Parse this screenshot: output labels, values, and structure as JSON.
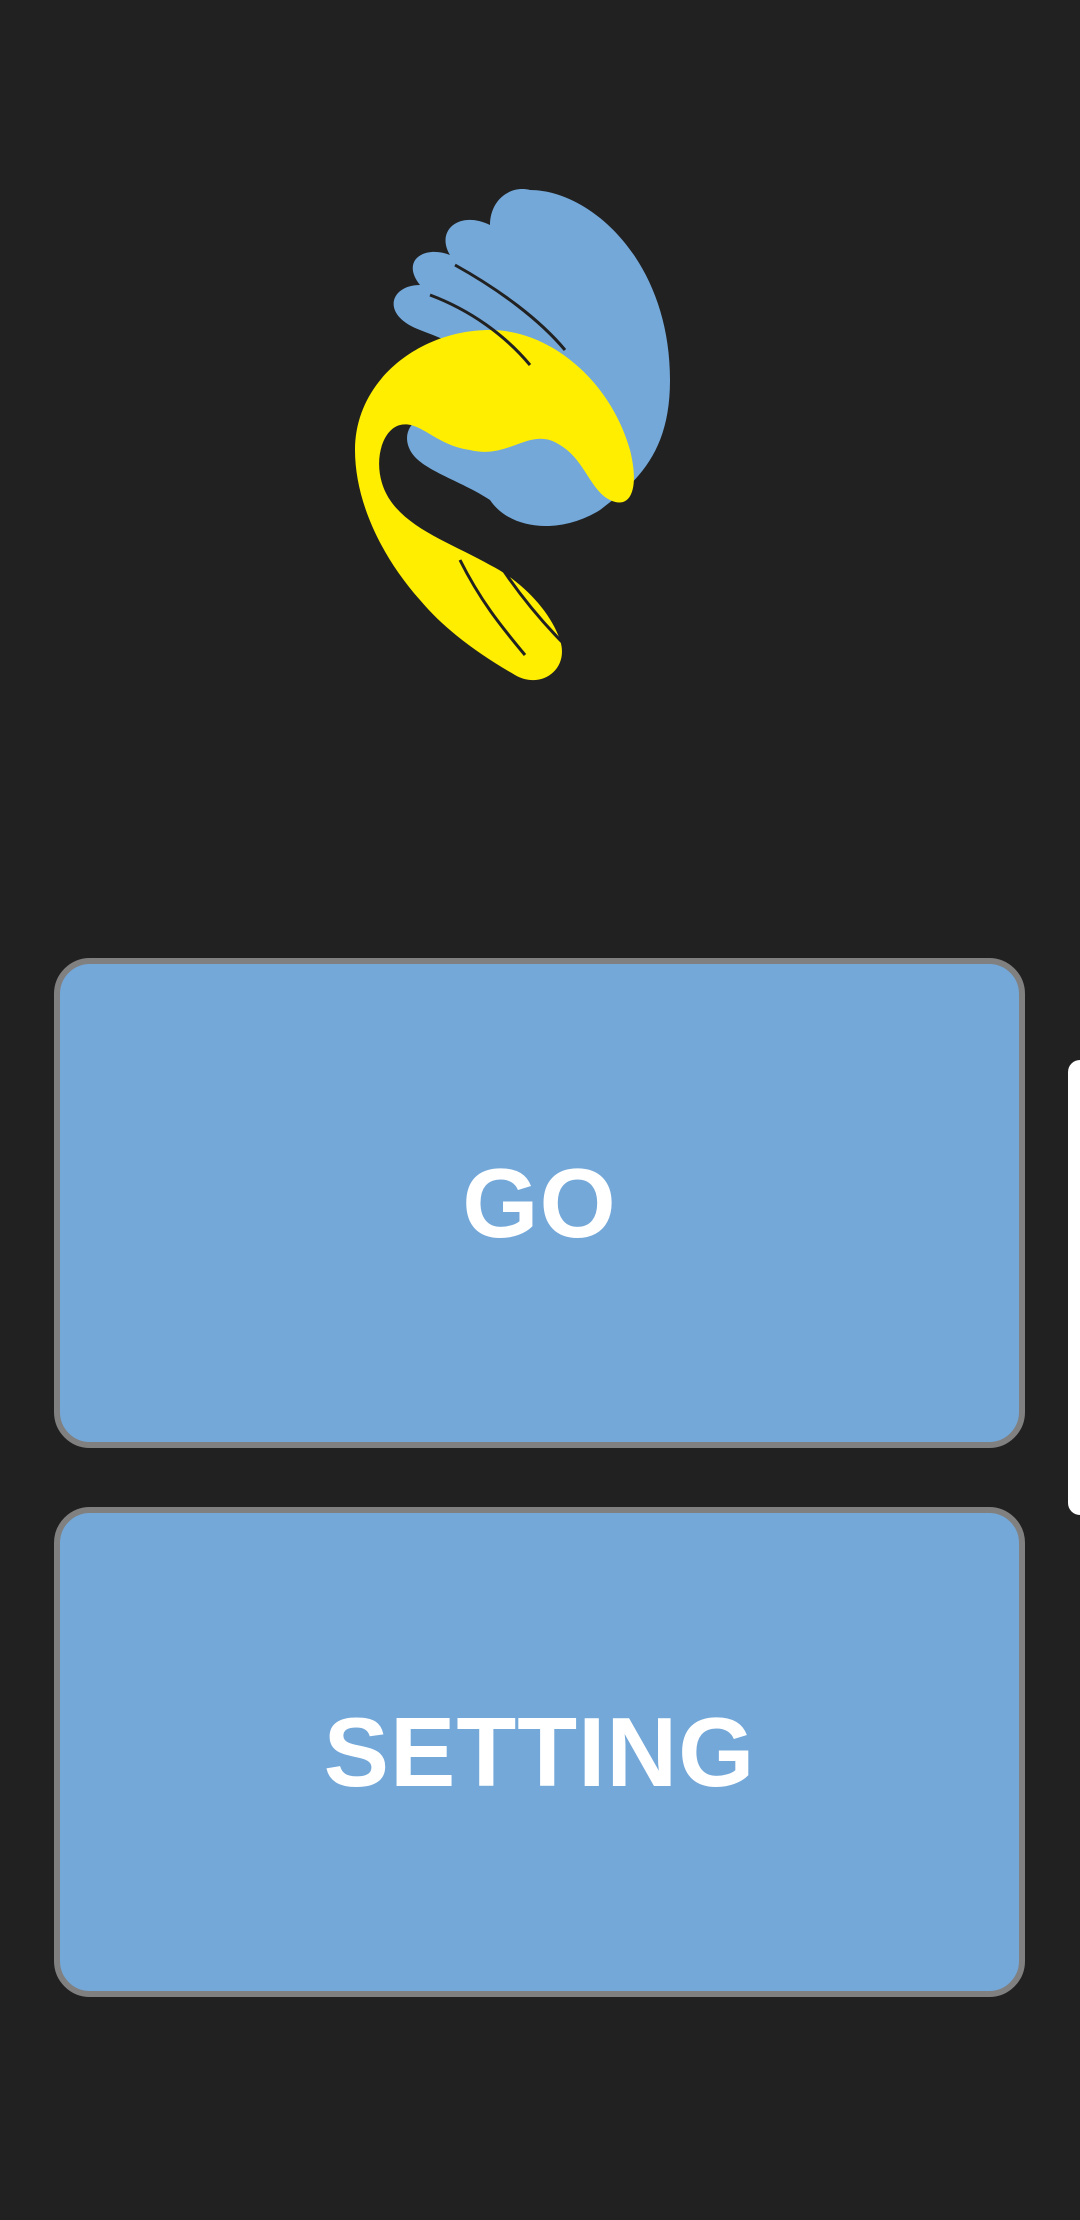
{
  "logo": {
    "icon": "two-hands-logo-icon",
    "colors": {
      "top_hand": "#74a8d9",
      "bottom_hand": "#ffee00"
    }
  },
  "buttons": {
    "go_label": "GO",
    "setting_label": "SETTING"
  },
  "colors": {
    "background": "#212121",
    "button_fill": "#74a8d9",
    "button_border": "#808080",
    "button_text": "#ffffff"
  }
}
